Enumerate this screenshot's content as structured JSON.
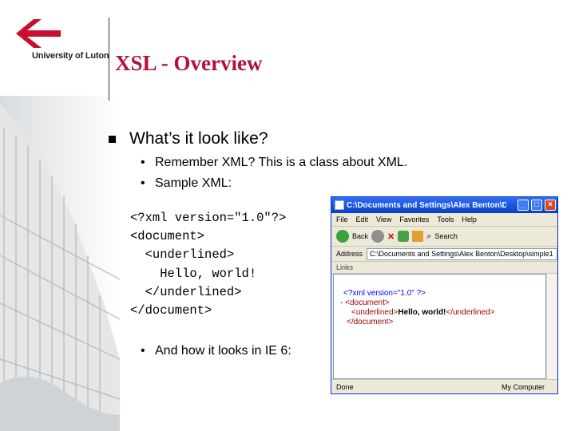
{
  "logo": {
    "institution": "University of Luton"
  },
  "slide": {
    "title": "XSL - Overview",
    "bullet": "What’s it look like?",
    "subbullets": [
      "Remember XML?  This is a class about XML.",
      "Sample XML:",
      "And how it looks in IE 6:"
    ],
    "bullet_glyph": "•",
    "code_lines": [
      "<?xml version=\"1.0\"?>",
      "<document>",
      "  <underlined>",
      "    Hello, world!",
      "  </underlined>",
      "</document>"
    ]
  },
  "ie": {
    "window_title": "C:\\Documents and Settings\\Alex Benton\\De...",
    "menu": [
      "File",
      "Edit",
      "View",
      "Favorites",
      "Tools",
      "Help"
    ],
    "toolbar": {
      "back_label": "Back",
      "search_label": "Search"
    },
    "address_label": "Address",
    "address_value": "C:\\Documents and Settings\\Alex Benton\\Desktop\\simple1",
    "links_label": "Links",
    "content": {
      "line1": "<?xml version=\"1.0\" ?>",
      "line2_marker": "-",
      "line2": "<document>",
      "line3_open": "<underlined>",
      "line3_text": "Hello, world!",
      "line3_close": "</underlined>",
      "line4": "</document>"
    },
    "status_left": "Done",
    "status_right": "My Computer"
  },
  "colors": {
    "title": "#b0123a",
    "logo_red": "#c8102e",
    "ie_titlebar": "#0a3fc7"
  }
}
